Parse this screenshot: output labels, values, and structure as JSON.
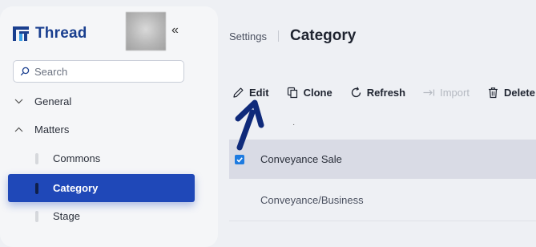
{
  "brand": {
    "name": "Thread",
    "accent": "#1a3f8f"
  },
  "sidebar": {
    "collapse_label": "«",
    "search_placeholder": "Search",
    "sections": [
      {
        "label": "General",
        "chevron": "chevron-down-icon"
      },
      {
        "label": "Matters",
        "chevron": "chevron-up-icon"
      }
    ],
    "items": [
      {
        "label": "Commons"
      },
      {
        "label": "Category",
        "active": true
      },
      {
        "label": "Stage"
      }
    ],
    "active_color": "#1f48b8"
  },
  "breadcrumb": {
    "parent": "Settings",
    "title": "Category"
  },
  "toolbar": {
    "edit": "Edit",
    "clone": "Clone",
    "refresh": "Refresh",
    "import": "Import",
    "delete": "Delete"
  },
  "table": {
    "rows": [
      {
        "label": "Conveyance Sale",
        "checked": true
      },
      {
        "label": "Conveyance/Business",
        "checked": false
      }
    ]
  },
  "annotation": {
    "arrow_color": "#0f2a7a"
  }
}
